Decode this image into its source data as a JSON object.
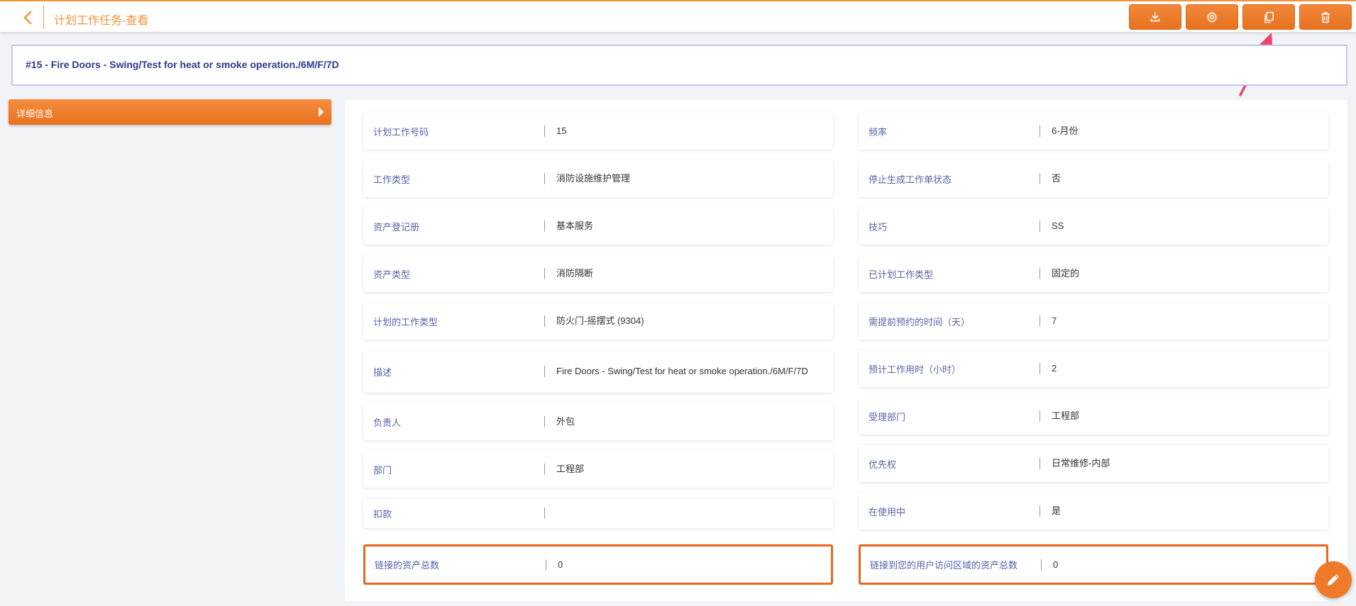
{
  "header": {
    "title": "计划工作任务-查看",
    "back_icon": "chevron-left-icon",
    "actions": [
      {
        "name": "download-button",
        "icon": "download-icon"
      },
      {
        "name": "settings-button",
        "icon": "gear-icon"
      },
      {
        "name": "copy-button",
        "icon": "copy-icon"
      },
      {
        "name": "delete-button",
        "icon": "trash-icon"
      }
    ]
  },
  "record": {
    "title": "#15 - Fire Doors - Swing/Test for heat or smoke operation./6M/F/7D"
  },
  "sidebar": {
    "tab_label": "详细信息"
  },
  "details": {
    "left": [
      {
        "label": "计划工作号码",
        "value": "15"
      },
      {
        "label": "工作类型",
        "value": "消防设施维护管理"
      },
      {
        "label": "资产登记册",
        "value": "基本服务"
      },
      {
        "label": "资产类型",
        "value": "消防隔断"
      },
      {
        "label": "计划的工作类型",
        "value": "防火门-摇摆式 (9304)"
      },
      {
        "label": "描述",
        "value": "Fire Doors - Swing/Test for heat or smoke operation./6M/F/7D"
      },
      {
        "label": "负责人",
        "value": "外包"
      },
      {
        "label": "部门",
        "value": "工程部"
      },
      {
        "label": "扣款",
        "value": ""
      },
      {
        "label": "链接的资产总数",
        "value": "0"
      }
    ],
    "right": [
      {
        "label": "频率",
        "value": "6-月份"
      },
      {
        "label": "停止生成工作单状态",
        "value": "否"
      },
      {
        "label": "技巧",
        "value": "SS"
      },
      {
        "label": "已计划工作类型",
        "value": "固定的"
      },
      {
        "label": "需提前预约的时间（天）",
        "value": "7"
      },
      {
        "label": "预计工作用时（小时）",
        "value": "2"
      },
      {
        "label": "受理部门",
        "value": "工程部"
      },
      {
        "label": "优先权",
        "value": "日常维修-内部"
      },
      {
        "label": "在使用中",
        "value": "是"
      },
      {
        "label": "链接到您的用户访问区域的资产总数",
        "value": "0"
      }
    ]
  },
  "colors": {
    "accent": "#f0953c",
    "button": "#e5721f",
    "label": "#5663a8",
    "title": "#2d3a8c",
    "highlight_border": "#e8661e",
    "annotation_arrow": "#f0436a"
  },
  "fab_icon": "pencil-icon"
}
